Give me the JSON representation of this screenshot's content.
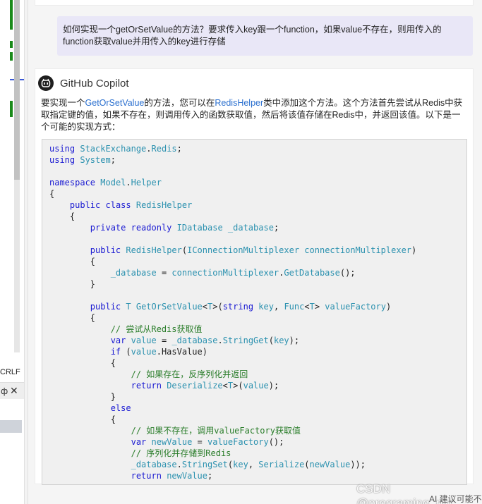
{
  "editor": {
    "line_ending": "CRLF",
    "pane_tab_glyph": "ф",
    "pane_close_glyph": "✕"
  },
  "chat": {
    "user_message": "如何实现一个getOrSetValue的方法？要求传入key跟一个function，如果value不存在，则用传入的function获取value并用传入的key进行存储",
    "assistant_name": "GitHub Copilot",
    "intro": {
      "p1": "要实现一个",
      "method_name": "GetOrSetValue",
      "p2": "的方法，您可以在",
      "class_name": "RedisHelper",
      "p3": "类中添加这个方法。这个方法首先尝试从Redis中获取指定键的值，如果不存在，则调用传入的函数获取值，然后将该值存储在Redis中，并返回该值。以下是一个可能的实现方式："
    }
  },
  "code_lines": [
    "using StackExchange.Redis;",
    "using System;",
    "",
    "namespace Model.Helper",
    "{",
    "    public class RedisHelper",
    "    {",
    "        private readonly IDatabase _database;",
    "",
    "        public RedisHelper(IConnectionMultiplexer connectionMultiplexer)",
    "        {",
    "            _database = connectionMultiplexer.GetDatabase();",
    "        }",
    "",
    "        public T GetOrSetValue<T>(string key, Func<T> valueFactory)",
    "        {",
    "            // 尝试从Redis获取值",
    "            var value = _database.StringGet(key);",
    "            if (value.HasValue)",
    "            {",
    "                // 如果存在，反序列化并返回",
    "                return Deserialize<T>(value);",
    "            }",
    "            else",
    "            {",
    "                // 如果不存在，调用valueFactory获取值",
    "                var newValue = valueFactory();",
    "                // 序列化并存储到Redis",
    "                _database.StringSet(key, Serialize(newValue));",
    "                return newValue;"
  ],
  "footer": {
    "watermark": "CSDN @programing_pig",
    "disclaimer": "AI 建议可能不准确。"
  },
  "colors": {
    "keyword": "#1a1ad2",
    "type": "#2b91af",
    "comment": "#2a7d2a",
    "link": "#2a6fcf",
    "user_bubble": "#e9e7f7",
    "change_marker": "#1a8a1a"
  }
}
